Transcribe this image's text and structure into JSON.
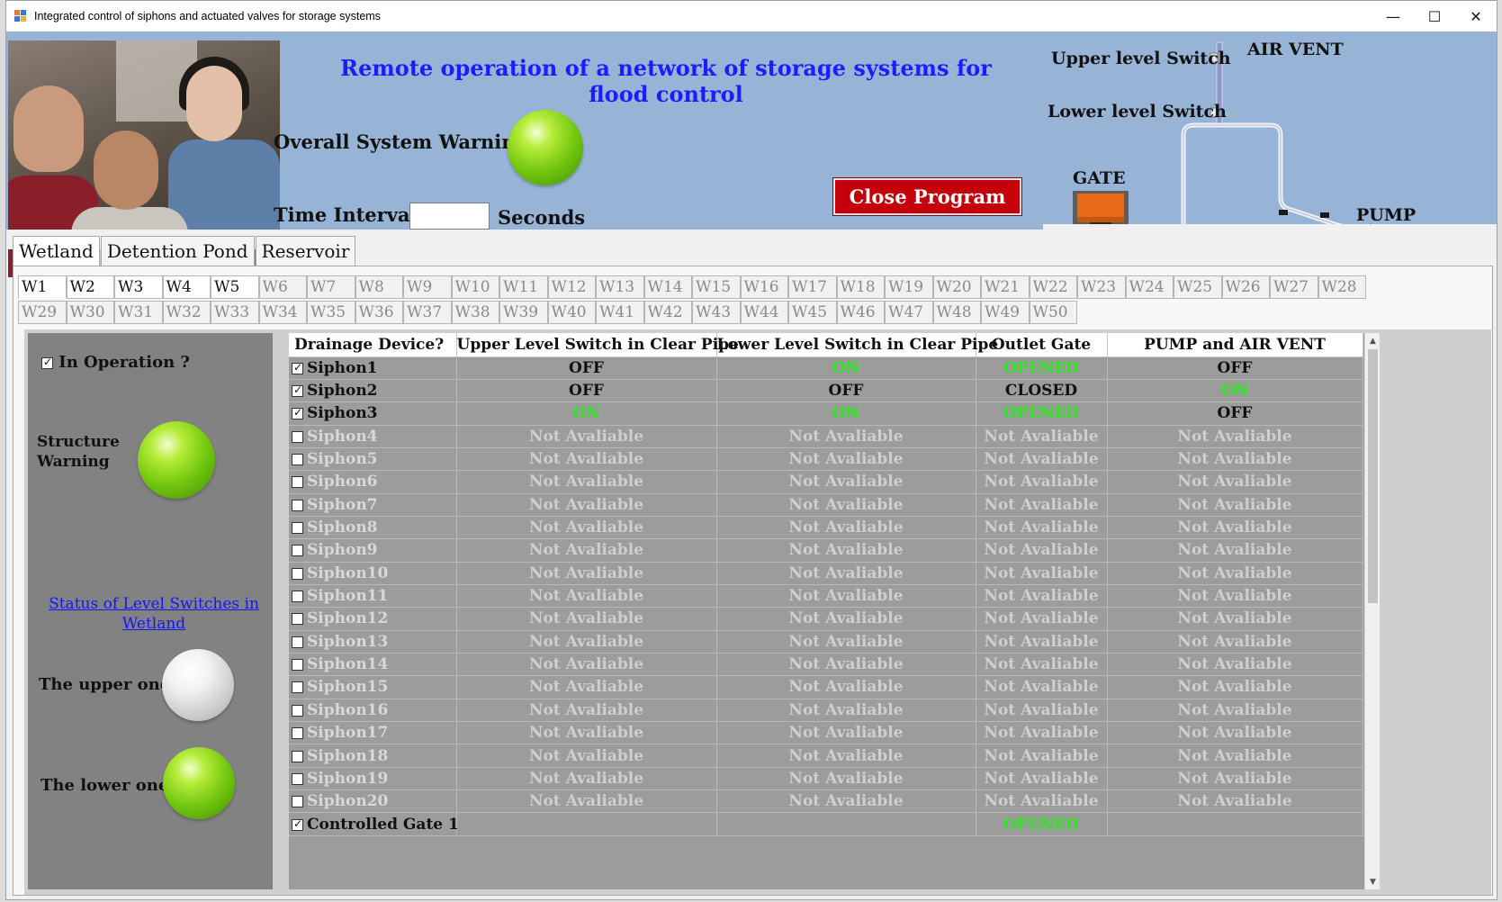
{
  "window": {
    "title": "Integrated control of siphons and actuated valves for storage systems",
    "minimize": "—",
    "maximize": "☐",
    "close": "✕"
  },
  "header": {
    "main_title": "Remote operation of a network of storage systems for flood control",
    "overall_warning_label": "Overall System Warning",
    "overall_warning_state": "green",
    "time_interval_label": "Time Interval",
    "time_interval_value": "",
    "seconds_label": "Seconds",
    "close_button": "Close Program"
  },
  "diagram": {
    "upper_switch": "Upper level Switch",
    "lower_switch": "Lower level Switch",
    "air_vent": "AIR VENT",
    "gate": "GATE",
    "pump": "PUMP"
  },
  "top_tabs": [
    "Wetland",
    "Detention Pond",
    "Reservoir"
  ],
  "w_tabs": {
    "row1": [
      "W1",
      "W2",
      "W3",
      "W4",
      "W5",
      "W6",
      "W7",
      "W8",
      "W9",
      "W10",
      "W11",
      "W12",
      "W13",
      "W14",
      "W15",
      "W16",
      "W17",
      "W18",
      "W19",
      "W20",
      "W21",
      "W22",
      "W23",
      "W24",
      "W25",
      "W26",
      "W27",
      "W28"
    ],
    "row2": [
      "W29",
      "W30",
      "W31",
      "W32",
      "W33",
      "W34",
      "W35",
      "W36",
      "W37",
      "W38",
      "W39",
      "W40",
      "W41",
      "W42",
      "W43",
      "W44",
      "W45",
      "W46",
      "W47",
      "W48",
      "W49",
      "W50"
    ],
    "active": "W1"
  },
  "left_panel": {
    "in_operation_label": "In Operation ?",
    "in_operation_checked": true,
    "structure_warning_line1": "Structure",
    "structure_warning_line2": "Warning",
    "structure_warning_state": "green",
    "status_link": "Status of Level Switches in Wetland",
    "upper_label": "The upper one",
    "upper_state": "white",
    "lower_label": "The lower one",
    "lower_state": "green"
  },
  "table": {
    "headers": [
      "Drainage Device?",
      "Upper Level Switch in Clear Pipe",
      "Lower Level Switch in Clear Pipe",
      "Outlet Gate",
      "PUMP and AIR VENT"
    ],
    "rows": [
      {
        "device": "Siphon1",
        "checked": true,
        "upper": "OFF",
        "lower": "ON",
        "gate": "OPENED",
        "pump": "OFF"
      },
      {
        "device": "Siphon2",
        "checked": true,
        "upper": "OFF",
        "lower": "OFF",
        "gate": "CLOSED",
        "pump": "ON"
      },
      {
        "device": "Siphon3",
        "checked": true,
        "upper": "ON",
        "lower": "ON",
        "gate": "OPENED",
        "pump": "OFF"
      },
      {
        "device": "Siphon4",
        "checked": false,
        "upper": "Not Avaliable",
        "lower": "Not Avaliable",
        "gate": "Not Avaliable",
        "pump": "Not Avaliable"
      },
      {
        "device": "Siphon5",
        "checked": false,
        "upper": "Not Avaliable",
        "lower": "Not Avaliable",
        "gate": "Not Avaliable",
        "pump": "Not Avaliable"
      },
      {
        "device": "Siphon6",
        "checked": false,
        "upper": "Not Avaliable",
        "lower": "Not Avaliable",
        "gate": "Not Avaliable",
        "pump": "Not Avaliable"
      },
      {
        "device": "Siphon7",
        "checked": false,
        "upper": "Not Avaliable",
        "lower": "Not Avaliable",
        "gate": "Not Avaliable",
        "pump": "Not Avaliable"
      },
      {
        "device": "Siphon8",
        "checked": false,
        "upper": "Not Avaliable",
        "lower": "Not Avaliable",
        "gate": "Not Avaliable",
        "pump": "Not Avaliable"
      },
      {
        "device": "Siphon9",
        "checked": false,
        "upper": "Not Avaliable",
        "lower": "Not Avaliable",
        "gate": "Not Avaliable",
        "pump": "Not Avaliable"
      },
      {
        "device": "Siphon10",
        "checked": false,
        "upper": "Not Avaliable",
        "lower": "Not Avaliable",
        "gate": "Not Avaliable",
        "pump": "Not Avaliable"
      },
      {
        "device": "Siphon11",
        "checked": false,
        "upper": "Not Avaliable",
        "lower": "Not Avaliable",
        "gate": "Not Avaliable",
        "pump": "Not Avaliable"
      },
      {
        "device": "Siphon12",
        "checked": false,
        "upper": "Not Avaliable",
        "lower": "Not Avaliable",
        "gate": "Not Avaliable",
        "pump": "Not Avaliable"
      },
      {
        "device": "Siphon13",
        "checked": false,
        "upper": "Not Avaliable",
        "lower": "Not Avaliable",
        "gate": "Not Avaliable",
        "pump": "Not Avaliable"
      },
      {
        "device": "Siphon14",
        "checked": false,
        "upper": "Not Avaliable",
        "lower": "Not Avaliable",
        "gate": "Not Avaliable",
        "pump": "Not Avaliable"
      },
      {
        "device": "Siphon15",
        "checked": false,
        "upper": "Not Avaliable",
        "lower": "Not Avaliable",
        "gate": "Not Avaliable",
        "pump": "Not Avaliable"
      },
      {
        "device": "Siphon16",
        "checked": false,
        "upper": "Not Avaliable",
        "lower": "Not Avaliable",
        "gate": "Not Avaliable",
        "pump": "Not Avaliable"
      },
      {
        "device": "Siphon17",
        "checked": false,
        "upper": "Not Avaliable",
        "lower": "Not Avaliable",
        "gate": "Not Avaliable",
        "pump": "Not Avaliable"
      },
      {
        "device": "Siphon18",
        "checked": false,
        "upper": "Not Avaliable",
        "lower": "Not Avaliable",
        "gate": "Not Avaliable",
        "pump": "Not Avaliable"
      },
      {
        "device": "Siphon19",
        "checked": false,
        "upper": "Not Avaliable",
        "lower": "Not Avaliable",
        "gate": "Not Avaliable",
        "pump": "Not Avaliable"
      },
      {
        "device": "Siphon20",
        "checked": false,
        "upper": "Not Avaliable",
        "lower": "Not Avaliable",
        "gate": "Not Avaliable",
        "pump": "Not Avaliable"
      },
      {
        "device": "Controlled Gate 1",
        "checked": true,
        "upper": "",
        "lower": "",
        "gate": "OPENED",
        "pump": ""
      }
    ]
  },
  "colors": {
    "header_bg": "#97b4d6",
    "title_blue": "#1c1cff",
    "close_red": "#c4010b",
    "status_on_green": "#2ee61f",
    "grid_bg": "#9c9c9c",
    "panel_gray": "#828282"
  }
}
